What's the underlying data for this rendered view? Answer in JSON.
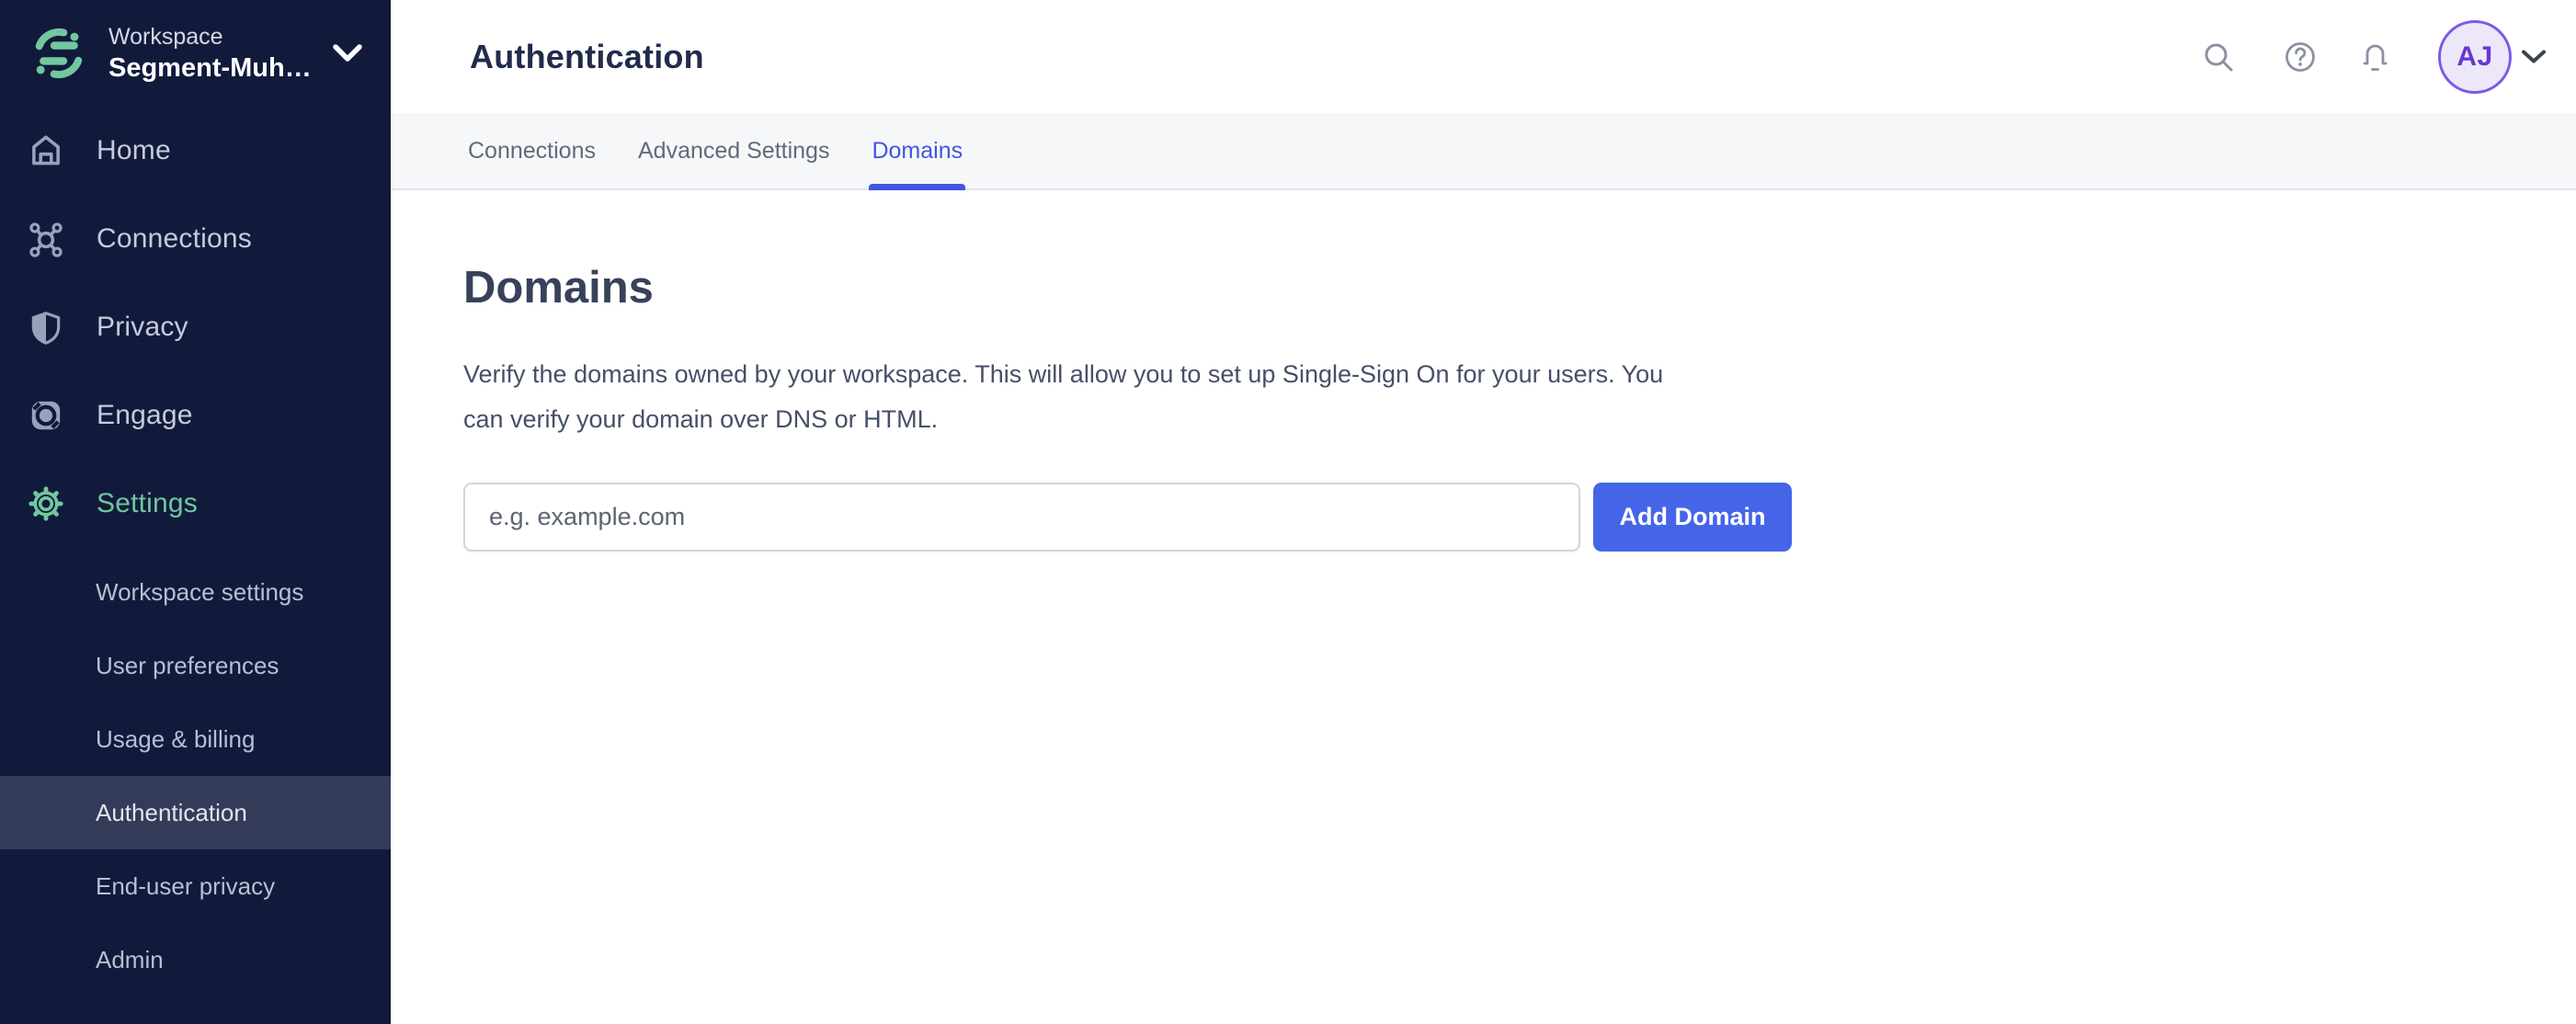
{
  "sidebar": {
    "workspace_label": "Workspace",
    "workspace_name": "Segment-Muh…",
    "nav_items": [
      {
        "label": "Home",
        "icon": "home-icon",
        "active": false
      },
      {
        "label": "Connections",
        "icon": "connections-icon",
        "active": false
      },
      {
        "label": "Privacy",
        "icon": "shield-icon",
        "active": false
      },
      {
        "label": "Engage",
        "icon": "engage-icon",
        "active": false
      },
      {
        "label": "Settings",
        "icon": "gear-icon",
        "active": true
      }
    ],
    "settings_subnav": [
      {
        "label": "Workspace settings",
        "active": false
      },
      {
        "label": "User preferences",
        "active": false
      },
      {
        "label": "Usage & billing",
        "active": false
      },
      {
        "label": "Authentication",
        "active": true
      },
      {
        "label": "End-user privacy",
        "active": false
      },
      {
        "label": "Admin",
        "active": false
      }
    ]
  },
  "topbar": {
    "title": "Authentication",
    "icons": [
      "search-icon",
      "help-icon",
      "bell-icon"
    ],
    "avatar_initials": "AJ"
  },
  "tabs": [
    {
      "label": "Connections",
      "active": false
    },
    {
      "label": "Advanced Settings",
      "active": false
    },
    {
      "label": "Domains",
      "active": true
    }
  ],
  "content": {
    "heading": "Domains",
    "description_lines": [
      "Verify the domains owned by your workspace. This will allow you to set up Single-Sign On for your users. You",
      "can verify your domain over DNS or HTML."
    ],
    "domain_input": {
      "value": "",
      "placeholder": "e.g. example.com"
    },
    "add_domain_button": "Add Domain"
  },
  "colors": {
    "sidebar_bg": "#121a3c",
    "sidebar_active_row": "#343b58",
    "brand_green": "#73c79f",
    "tab_active_blue": "#4156e0",
    "button_blue": "#4565e8",
    "tabstrip_bg": "#f6f7f9",
    "avatar_border": "#7d59e8",
    "avatar_bg": "#ece8fa",
    "avatar_text": "#6936d3"
  }
}
